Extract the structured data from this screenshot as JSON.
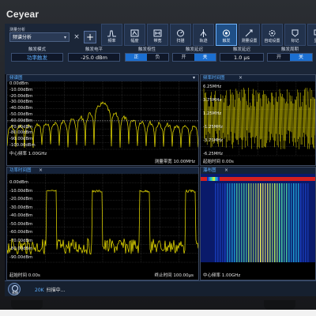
{
  "brand": "Ceyear",
  "analysis": {
    "header": "测量分析",
    "selected": "频谱分析"
  },
  "toolbar": [
    {
      "label": "频率",
      "icon": "frequency-icon"
    },
    {
      "label": "幅度",
      "icon": "amplitude-icon"
    },
    {
      "label": "带宽",
      "icon": "bandwidth-icon"
    },
    {
      "label": "扫描",
      "icon": "sweep-icon"
    },
    {
      "label": "轨迹",
      "icon": "trace-icon"
    },
    {
      "label": "触发",
      "icon": "trigger-icon",
      "active": true
    },
    {
      "label": "测量设置",
      "icon": "measure-setup-icon"
    },
    {
      "label": "自动设置",
      "icon": "auto-setup-icon"
    },
    {
      "label": "标记",
      "icon": "marker-icon"
    },
    {
      "label": "显示",
      "icon": "display-icon"
    }
  ],
  "fields": {
    "trigger_mode": {
      "label": "触发模式",
      "value": "功率触发"
    },
    "trigger_level": {
      "label": "触发电平",
      "value": "-25.0 dBm"
    },
    "trigger_polarity": {
      "label": "触发极性",
      "options": [
        "正",
        "负"
      ],
      "selected": "正"
    },
    "trigger_delay": {
      "label": "触发延迟",
      "options": [
        "开",
        "关"
      ],
      "selected": "关"
    },
    "trigger_holdoff": {
      "label": "触发延迟",
      "value": "1.0 μs"
    },
    "trigger_cycle": {
      "label": "触发周期",
      "options": [
        "开",
        "关"
      ],
      "selected": "关"
    }
  },
  "panels": {
    "spectrum": {
      "title": "频谱图",
      "ref_levels": [
        "0.00dBm",
        "-10.00dBm",
        "-20.00dBm",
        "-30.00dBm",
        "-40.00dBm",
        "-50.00dBm",
        "-60.00dBm",
        "-70.00dBm",
        "-80.00dBm",
        "-90.00dBm",
        "-100.00dBm"
      ],
      "center": "中心频率 1.00GHz",
      "rbw": "测量带宽 10.00MHz"
    },
    "freq_time": {
      "title": "频率时间图",
      "levels": [
        "6.25MHz",
        "3.75MHz",
        "1.25MHz",
        "-1.25MHz",
        "-3.75MHz",
        "-6.25MHz"
      ],
      "start": "起始时间 0.00s"
    },
    "power_time": {
      "title": "功率时间图",
      "ref_levels": [
        "0.00dBm",
        "-10.00dBm",
        "-20.00dBm",
        "-30.00dBm",
        "-40.00dBm",
        "-50.00dBm",
        "-60.00dBm",
        "-70.00dBm",
        "-80.00dBm",
        "-90.00dBm"
      ],
      "start": "起始时间 0.00s",
      "stop": "终止时间 100.00μs"
    },
    "waterfall": {
      "title": "瀑布图",
      "center": "中心频率 1.00GHz"
    }
  },
  "status": {
    "sys_label": "系统",
    "mode": "20K",
    "text": "扫描中..."
  },
  "colors": {
    "trace": "#f5e900",
    "accent": "#5fb0ff",
    "active": "#1b6fd1"
  }
}
